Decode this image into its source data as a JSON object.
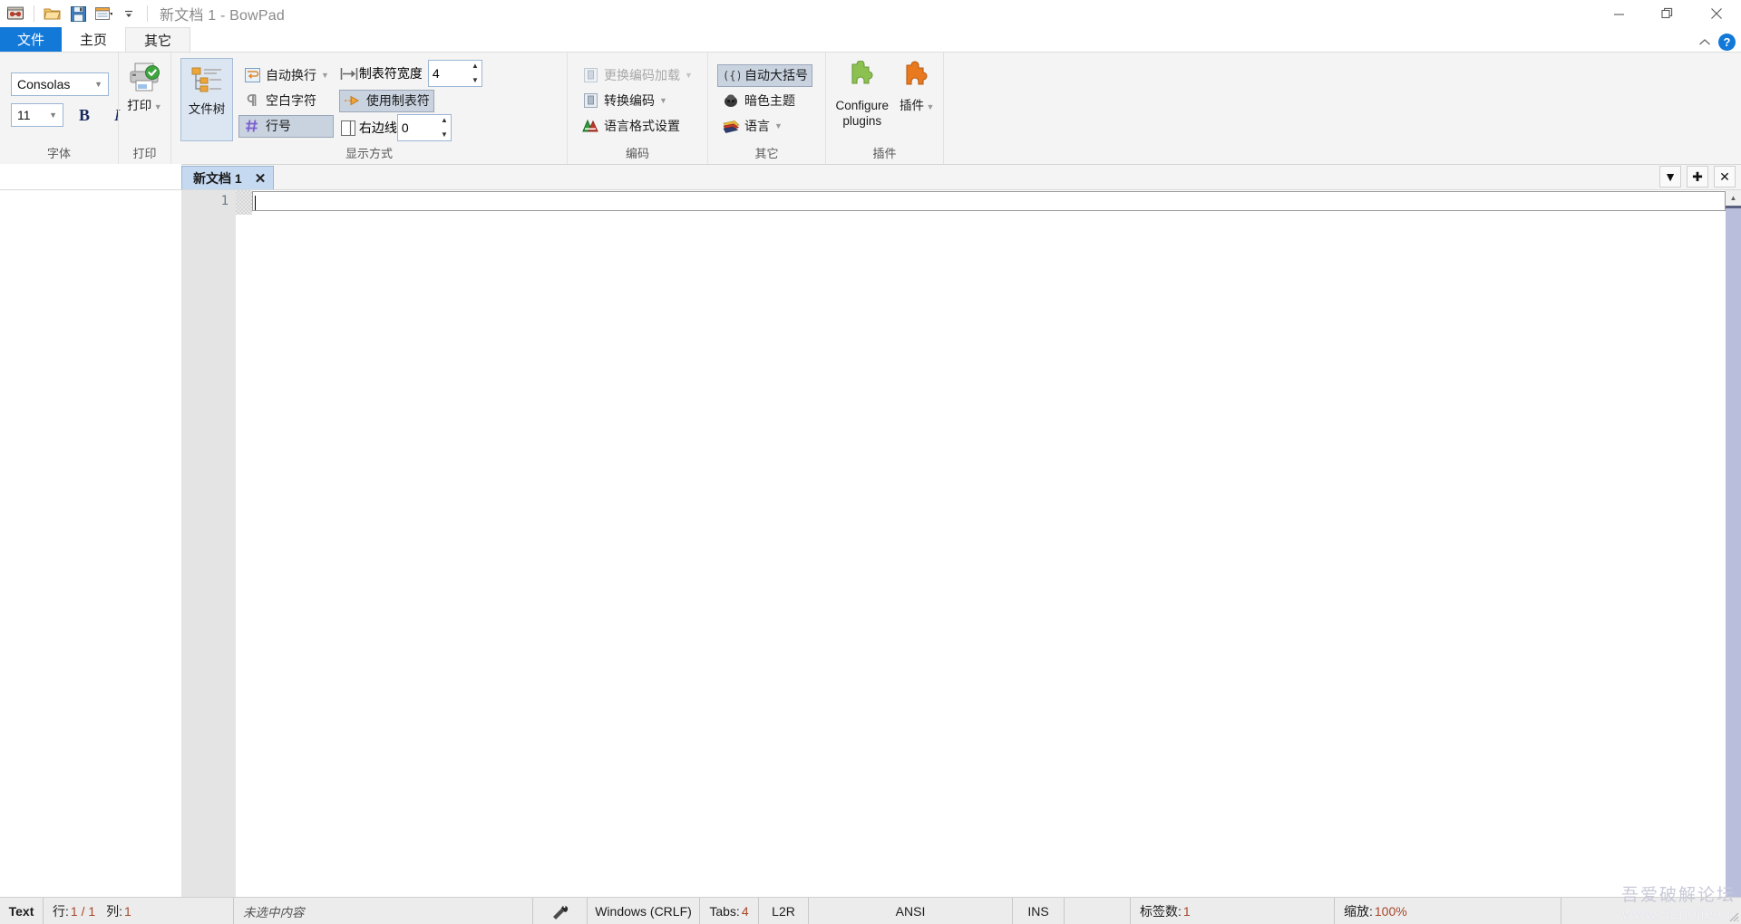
{
  "window": {
    "title": "新文档 1 - BowPad",
    "minimize_label": "minimize",
    "restore_label": "restore",
    "close_label": "close"
  },
  "quick_access": {
    "app_icon": "bowpad-icon",
    "open_label": "open",
    "save_label": "save",
    "layout_label": "layout",
    "more_label": "more"
  },
  "ribbon_tabs": {
    "file": "文件",
    "home": "主页",
    "other": "其它",
    "help": "?"
  },
  "groups": {
    "font": {
      "label": "字体",
      "font_name": "Consolas",
      "font_size": "11",
      "bold": "B",
      "italic": "I"
    },
    "print": {
      "label": "打印",
      "button": "打印"
    },
    "view": {
      "label": "显示方式",
      "filetree": "文件树",
      "word_wrap": "自动换行",
      "whitespace": "空白字符",
      "line_numbers": "行号",
      "tab_width_label": "制表符宽度",
      "tab_width_value": "4",
      "use_tabs": "使用制表符",
      "right_margin_label": "右边线",
      "right_margin_value": "0"
    },
    "encoding": {
      "label": "编码",
      "reload_as": "更换编码加载",
      "convert": "转换编码",
      "lang_format": "语言格式设置"
    },
    "other": {
      "label": "其它",
      "auto_braces": "自动大括号",
      "dark_theme": "暗色主题",
      "language": "语言"
    },
    "plugins": {
      "label": "插件",
      "configure": "Configure plugins",
      "plugins_btn": "插件"
    }
  },
  "tabstrip": {
    "doc_tab": "新文档 1",
    "close_tab": "✕",
    "dropdown": "▼",
    "new_tab": "✚",
    "close_all": "✕"
  },
  "editor": {
    "line_number": "1",
    "content": ""
  },
  "statusbar": {
    "doc_type": "Text",
    "position_label": "行:",
    "position_value": "1 / 1",
    "column_label": "列:",
    "column_value": "1",
    "selection": "未选中内容",
    "eol": "Windows (CRLF)",
    "tabs_label": "Tabs:",
    "tabs_value": "4",
    "direction": "L2R",
    "encoding": "ANSI",
    "insert_mode": "INS",
    "tabcount_label": "标签数:",
    "tabcount_value": "1",
    "zoom_label": "缩放:",
    "zoom_value": "100%"
  },
  "watermark": {
    "line1": "吾爱破解论坛",
    "line2": "www.52pojie.cn"
  },
  "colors": {
    "accent": "#1379d8",
    "tab_active": "#c5d9f1",
    "ribbon_bg": "#f4f4f4",
    "status_bg": "#ececec",
    "status_number": "#a8472a"
  }
}
